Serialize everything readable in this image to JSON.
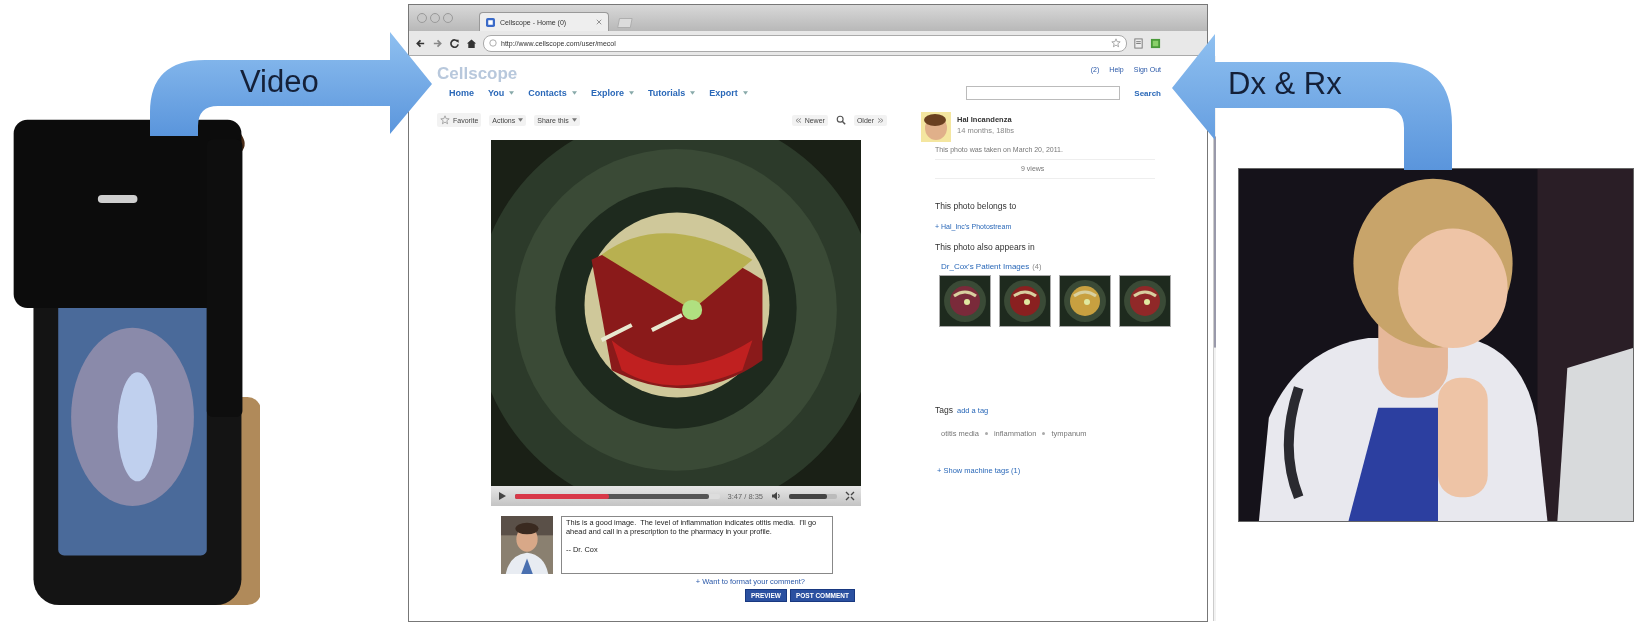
{
  "diagram": {
    "left_arrow": {
      "label": "Video"
    },
    "right_arrow": {
      "label": "Dx & Rx"
    }
  },
  "browser": {
    "tab": {
      "title": "Cellscope - Home (0)"
    },
    "address": "http://www.cellscope.com/user/mecol"
  },
  "site": {
    "logo": "Cellscope",
    "user_links": [
      "(2)",
      "Help",
      "Sign Out"
    ],
    "nav": [
      {
        "label": "Home",
        "dropdown": false
      },
      {
        "label": "You",
        "dropdown": true
      },
      {
        "label": "Contacts",
        "dropdown": true
      },
      {
        "label": "Explore",
        "dropdown": true
      },
      {
        "label": "Tutorials",
        "dropdown": true
      },
      {
        "label": "Export",
        "dropdown": true
      }
    ],
    "search_button": "Search"
  },
  "photo_toolbar": {
    "actions": [
      {
        "label": "Favorite",
        "kind": "favorite"
      },
      {
        "label": "Actions",
        "kind": "menu"
      },
      {
        "label": "Share this",
        "kind": "menu"
      }
    ],
    "newer": "Newer",
    "older": "Older"
  },
  "video": {
    "progress": {
      "level": 0.46
    },
    "buffered": {
      "level": 0.95
    },
    "time": "3:47 / 8:35",
    "volume": {
      "level": 0.8
    }
  },
  "comment": {
    "text": "This is a good image.  The level of inflammation indicates otitis media.  I'll go ahead and call in a prescription to the pharmacy in your profile.\n\n-- Dr. Cox",
    "format_link": "+ Want to format your comment?",
    "buttons": [
      "PREVIEW",
      "POST COMMENT"
    ]
  },
  "sidebar": {
    "owner": {
      "name": "Hal Incandenza",
      "detail": "14 months, 18lbs"
    },
    "taken": "This photo was taken on March 20, 2011.",
    "views": "9 views",
    "belongs_heading": "This photo belongs to",
    "photostream_link": "+ Hal_Inc's Photostream",
    "appears_heading": "This photo also appears in",
    "set": {
      "name": "Dr_Cox's Patient Images",
      "count": "(4)"
    },
    "tags": {
      "heading": "Tags",
      "add": "add a tag",
      "items": [
        "otitis media",
        "inflammation",
        "tympanum"
      ]
    },
    "machine_tags": "+ Show machine tags (1)"
  }
}
